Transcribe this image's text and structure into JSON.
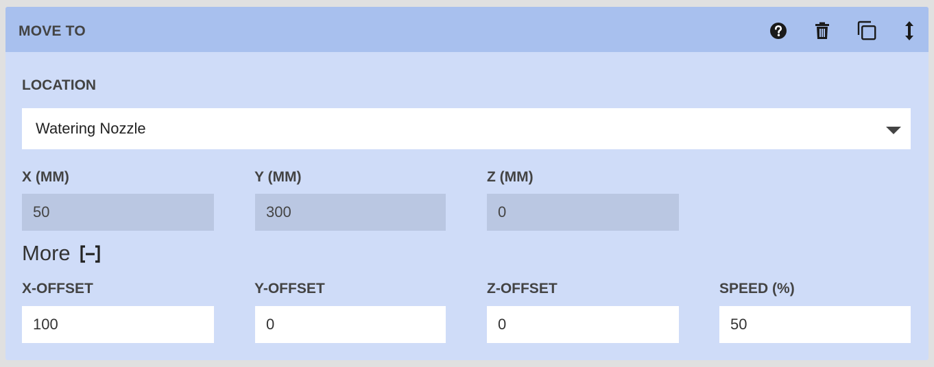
{
  "header": {
    "title": "MOVE TO",
    "icons": [
      "help-icon",
      "trash-icon",
      "duplicate-icon",
      "reorder-icon"
    ]
  },
  "location": {
    "label": "LOCATION",
    "selected": "Watering Nozzle"
  },
  "coords": {
    "x_label": "X (MM)",
    "x_value": "50",
    "y_label": "Y (MM)",
    "y_value": "300",
    "z_label": "Z (MM)",
    "z_value": "0"
  },
  "more": {
    "label": "More",
    "toggle": "[−]"
  },
  "offsets": {
    "x_label": "X-OFFSET",
    "x_value": "100",
    "y_label": "Y-OFFSET",
    "y_value": "0",
    "z_label": "Z-OFFSET",
    "z_value": "0",
    "speed_label": "SPEED (%)",
    "speed_value": "50"
  },
  "colors": {
    "header_bg": "#a8c0ee",
    "body_bg": "#cfdcf8",
    "disabled_input_bg": "#bac7e2",
    "text": "#434343"
  }
}
